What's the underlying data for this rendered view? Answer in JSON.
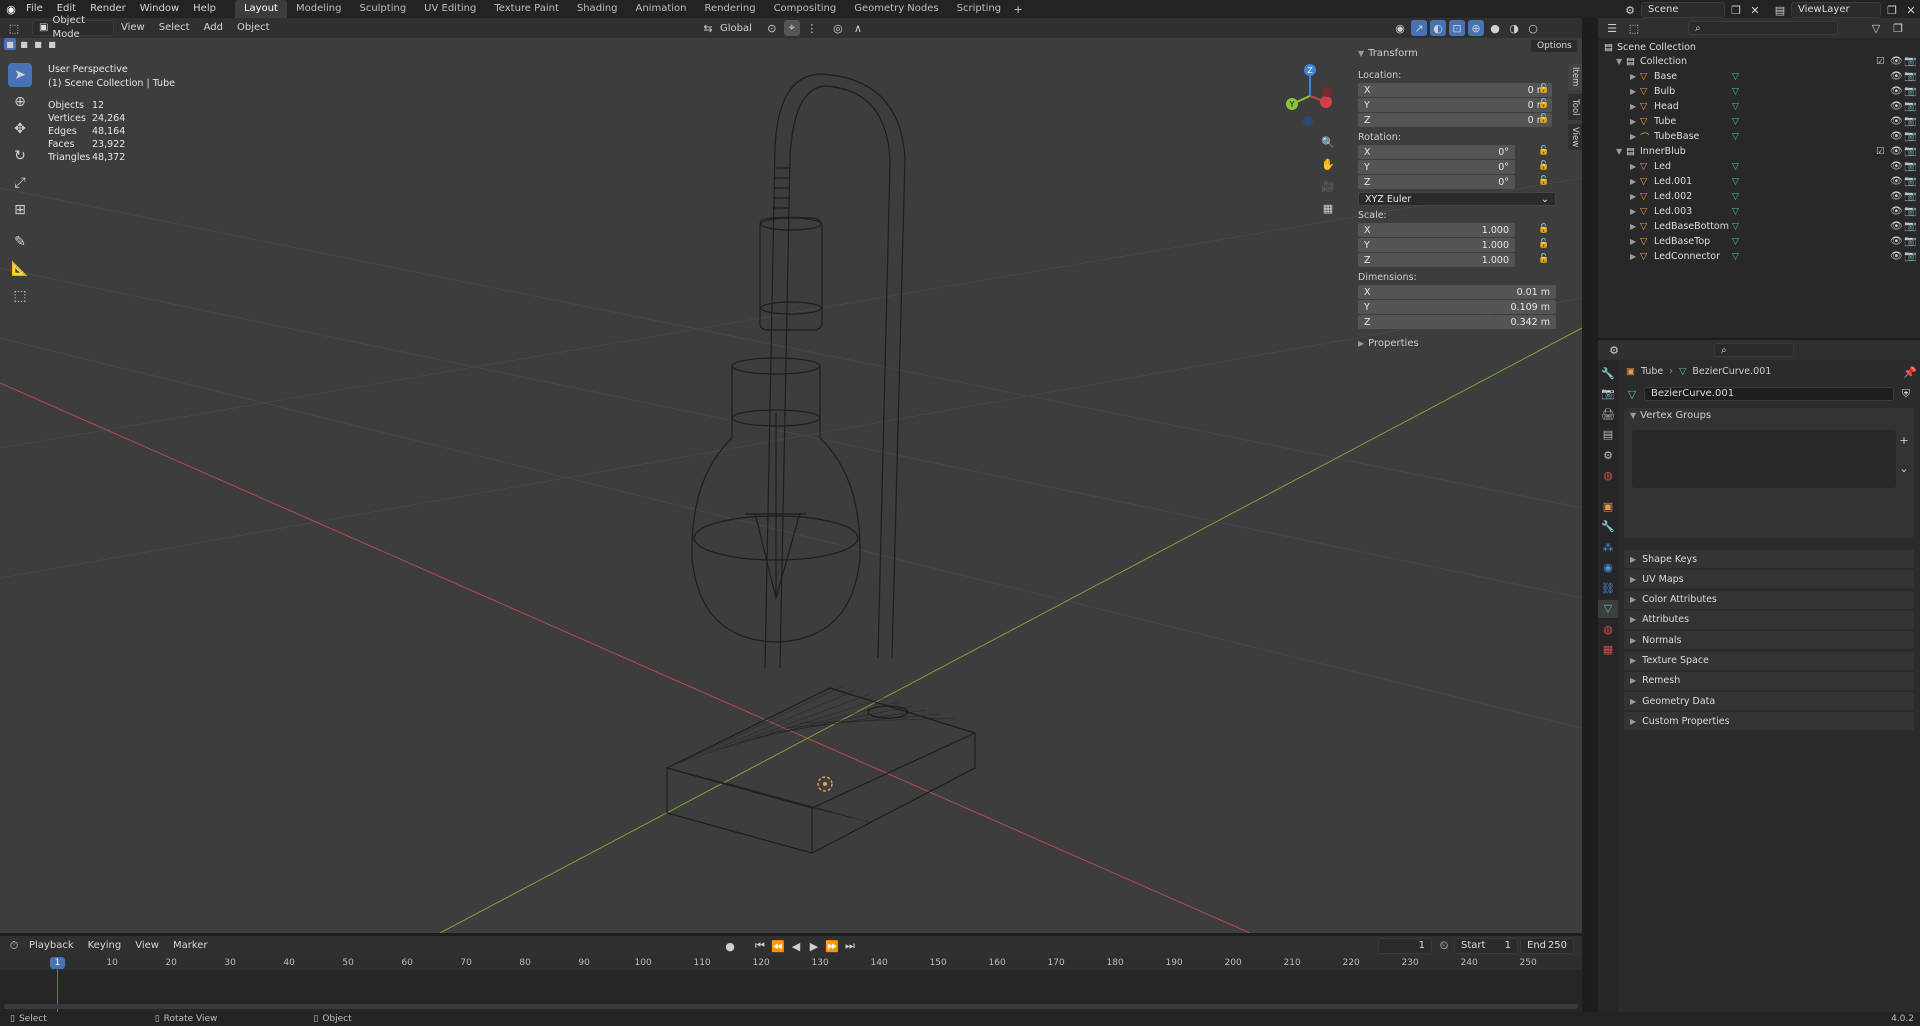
{
  "menu": [
    "File",
    "Edit",
    "Render",
    "Window",
    "Help"
  ],
  "workspaces": [
    {
      "label": "Layout",
      "active": true
    },
    {
      "label": "Modeling"
    },
    {
      "label": "Sculpting"
    },
    {
      "label": "UV Editing"
    },
    {
      "label": "Texture Paint"
    },
    {
      "label": "Shading"
    },
    {
      "label": "Animation"
    },
    {
      "label": "Rendering"
    },
    {
      "label": "Compositing"
    },
    {
      "label": "Geometry Nodes"
    },
    {
      "label": "Scripting"
    }
  ],
  "scene": {
    "name": "Scene",
    "view_layer": "ViewLayer"
  },
  "viewport_header": {
    "mode": "Object Mode",
    "menus": [
      "View",
      "Select",
      "Add",
      "Object"
    ],
    "transform_orientation": "Global",
    "options_label": "Options"
  },
  "overlay": {
    "perspective": "User Perspective",
    "context": "(1) Scene Collection | Tube",
    "stats": [
      {
        "label": "Objects",
        "value": "12"
      },
      {
        "label": "Vertices",
        "value": "24,264"
      },
      {
        "label": "Edges",
        "value": "48,164"
      },
      {
        "label": "Faces",
        "value": "23,922"
      },
      {
        "label": "Triangles",
        "value": "48,372"
      }
    ]
  },
  "n_panel": {
    "tabs": [
      "Item",
      "Tool",
      "View"
    ],
    "transform_title": "Transform",
    "location_label": "Location:",
    "location": [
      {
        "axis": "X",
        "value": "0 m"
      },
      {
        "axis": "Y",
        "value": "0 m"
      },
      {
        "axis": "Z",
        "value": "0 m"
      }
    ],
    "rotation_label": "Rotation:",
    "rotation": [
      {
        "axis": "X",
        "value": "0°"
      },
      {
        "axis": "Y",
        "value": "0°"
      },
      {
        "axis": "Z",
        "value": "0°"
      }
    ],
    "rotation_mode": "XYZ Euler",
    "scale_label": "Scale:",
    "scale": [
      {
        "axis": "X",
        "value": "1.000"
      },
      {
        "axis": "Y",
        "value": "1.000"
      },
      {
        "axis": "Z",
        "value": "1.000"
      }
    ],
    "dimensions_label": "Dimensions:",
    "dimensions": [
      {
        "axis": "X",
        "value": "0.01 m"
      },
      {
        "axis": "Y",
        "value": "0.109 m"
      },
      {
        "axis": "Z",
        "value": "0.342 m"
      }
    ],
    "properties_label": "Properties"
  },
  "outliner": {
    "root": "Scene Collection",
    "rows": [
      {
        "label": "Collection",
        "level": 1,
        "kind": "collection"
      },
      {
        "label": "Base",
        "level": 2,
        "kind": "object"
      },
      {
        "label": "Bulb",
        "level": 2,
        "kind": "object"
      },
      {
        "label": "Head",
        "level": 2,
        "kind": "object"
      },
      {
        "label": "Tube",
        "level": 2,
        "kind": "object"
      },
      {
        "label": "TubeBase",
        "level": 2,
        "kind": "curve"
      },
      {
        "label": "InnerBlub",
        "level": 1,
        "kind": "collection"
      },
      {
        "label": "Led",
        "level": 2,
        "kind": "object"
      },
      {
        "label": "Led.001",
        "level": 2,
        "kind": "object"
      },
      {
        "label": "Led.002",
        "level": 2,
        "kind": "object"
      },
      {
        "label": "Led.003",
        "level": 2,
        "kind": "object"
      },
      {
        "label": "LedBaseBottom",
        "level": 2,
        "kind": "object"
      },
      {
        "label": "LedBaseTop",
        "level": 2,
        "kind": "object"
      },
      {
        "label": "LedConnector",
        "level": 2,
        "kind": "object"
      }
    ]
  },
  "properties": {
    "breadcrumb_object": "Tube",
    "breadcrumb_data": "BezierCurve.001",
    "data_name": "BezierCurve.001",
    "vertex_groups_label": "Vertex Groups",
    "sections": [
      "Shape Keys",
      "UV Maps",
      "Color Attributes",
      "Attributes",
      "Normals",
      "Texture Space",
      "Remesh",
      "Geometry Data",
      "Custom Properties"
    ]
  },
  "timeline": {
    "menus": [
      "Playback",
      "Keying",
      "View",
      "Marker"
    ],
    "current_frame": "1",
    "start_label": "Start",
    "start": "1",
    "end_label": "End",
    "end": "250",
    "ticks": [
      "1",
      "10",
      "20",
      "30",
      "40",
      "50",
      "60",
      "70",
      "80",
      "90",
      "100",
      "110",
      "120",
      "130",
      "140",
      "150",
      "160",
      "170",
      "180",
      "190",
      "200",
      "210",
      "220",
      "230",
      "240",
      "250"
    ]
  },
  "status": {
    "select": "Select",
    "rotate": "Rotate View",
    "object": "Object",
    "version": "4.0.2"
  },
  "colors": {
    "accent": "#4772b3",
    "x_axis": "#d0404b",
    "y_axis": "#8ac43b",
    "z_axis": "#3f87d6",
    "object_orange": "#e39b4a",
    "mesh_green": "#49c596"
  }
}
